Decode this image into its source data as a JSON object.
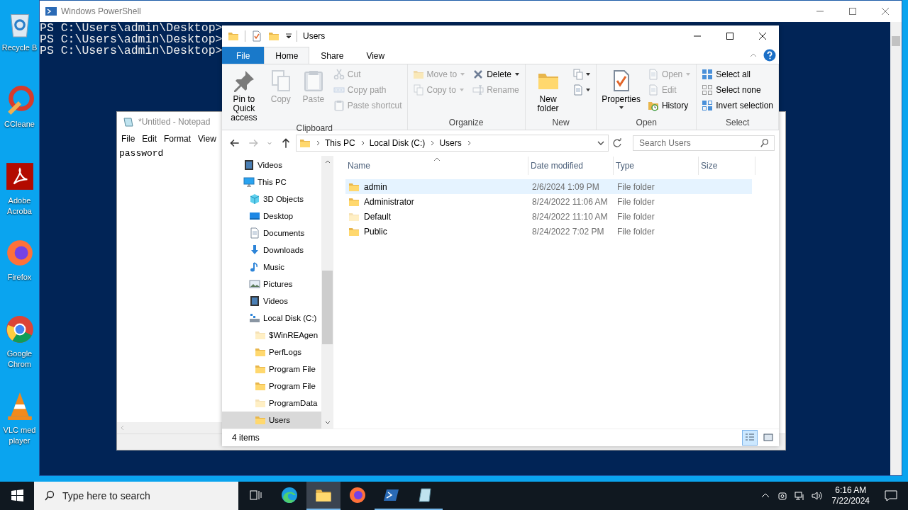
{
  "desktop": {
    "icons": [
      {
        "label": "Recycle B"
      },
      {
        "label": "CCleane"
      },
      {
        "label": "Adobe Acroba"
      },
      {
        "label": "Firefox"
      },
      {
        "label": "Google Chrom"
      },
      {
        "label": "VLC med player"
      }
    ]
  },
  "powershell": {
    "title": "Windows PowerShell",
    "lines": [
      "PS C:\\Users\\admin\\Desktop>",
      "PS C:\\Users\\admin\\Desktop>",
      "PS C:\\Users\\admin\\Desktop>"
    ]
  },
  "notepad": {
    "title": "*Untitled - Notepad",
    "menu": [
      "File",
      "Edit",
      "Format",
      "View"
    ],
    "text": "password"
  },
  "explorer": {
    "title": "Users",
    "tabs": [
      {
        "label": "File",
        "kind": "file",
        "selected": false
      },
      {
        "label": "Home",
        "kind": "tab",
        "selected": true
      },
      {
        "label": "Share",
        "kind": "tab",
        "selected": false
      },
      {
        "label": "View",
        "kind": "tab",
        "selected": false
      }
    ],
    "ribbon": {
      "groups": [
        {
          "label": "Clipboard",
          "columns": [
            [
              {
                "label": "Pin to Quick access",
                "kind": "large",
                "disabled": false
              }
            ],
            [
              {
                "label": "Copy",
                "kind": "large",
                "disabled": true
              }
            ],
            [
              {
                "label": "Paste",
                "kind": "large",
                "disabled": true
              }
            ],
            [
              {
                "label": "Cut",
                "kind": "small",
                "disabled": true
              },
              {
                "label": "Copy path",
                "kind": "small",
                "disabled": true
              },
              {
                "label": "Paste shortcut",
                "kind": "small",
                "disabled": true
              }
            ]
          ]
        },
        {
          "label": "Organize",
          "columns": [
            [
              {
                "label": "Move to",
                "kind": "small",
                "disabled": true,
                "dropdown": true
              },
              {
                "label": "Copy to",
                "kind": "small",
                "disabled": true,
                "dropdown": true
              }
            ],
            [
              {
                "label": "Delete",
                "kind": "small",
                "disabled": false,
                "dropdown": true
              },
              {
                "label": "Rename",
                "kind": "small",
                "disabled": true
              }
            ]
          ]
        },
        {
          "label": "New",
          "columns": [
            [
              {
                "label": "New folder",
                "kind": "large",
                "disabled": false
              }
            ],
            [
              {
                "kind": "icon",
                "disabled": false,
                "dropdown": true
              },
              {
                "kind": "icon",
                "disabled": false,
                "dropdown": true
              }
            ]
          ]
        },
        {
          "label": "Open",
          "columns": [
            [
              {
                "label": "Properties",
                "kind": "large",
                "disabled": false,
                "dropdown": true
              }
            ],
            [
              {
                "label": "Open",
                "kind": "small",
                "disabled": true,
                "dropdown": true
              },
              {
                "label": "Edit",
                "kind": "small",
                "disabled": true
              },
              {
                "label": "History",
                "kind": "small",
                "disabled": false
              }
            ]
          ]
        },
        {
          "label": "Select",
          "columns": [
            [
              {
                "label": "Select all",
                "kind": "small",
                "disabled": false
              },
              {
                "label": "Select none",
                "kind": "small",
                "disabled": false
              },
              {
                "label": "Invert selection",
                "kind": "small",
                "disabled": false
              }
            ]
          ]
        }
      ]
    },
    "address": {
      "crumbs": [
        "This PC",
        "Local Disk (C:)",
        "Users"
      ],
      "search_placeholder": "Search Users"
    },
    "nav": [
      {
        "label": "Videos",
        "selected": false,
        "hidden": false
      },
      {
        "label": "This PC",
        "selected": false,
        "hidden": false,
        "children": [
          {
            "label": "3D Objects",
            "selected": false,
            "hidden": false
          },
          {
            "label": "Desktop",
            "selected": false,
            "hidden": false
          },
          {
            "label": "Documents",
            "selected": false,
            "hidden": false
          },
          {
            "label": "Downloads",
            "selected": false,
            "hidden": false
          },
          {
            "label": "Music",
            "selected": false,
            "hidden": false
          },
          {
            "label": "Pictures",
            "selected": false,
            "hidden": false
          },
          {
            "label": "Videos",
            "selected": false,
            "hidden": false
          },
          {
            "label": "Local Disk (C:)",
            "selected": false,
            "hidden": false,
            "children": [
              {
                "label": "$WinREAgen",
                "selected": false,
                "hidden": true
              },
              {
                "label": "PerfLogs",
                "selected": false,
                "hidden": false
              },
              {
                "label": "Program File",
                "selected": false,
                "hidden": false
              },
              {
                "label": "Program File",
                "selected": false,
                "hidden": false
              },
              {
                "label": "ProgramData",
                "selected": false,
                "hidden": true
              },
              {
                "label": "Users",
                "selected": true,
                "hidden": false
              }
            ]
          }
        ]
      }
    ],
    "columns": [
      {
        "label": "Name",
        "sorted": true
      },
      {
        "label": "Date modified",
        "sorted": false
      },
      {
        "label": "Type",
        "sorted": false
      },
      {
        "label": "Size",
        "sorted": false
      }
    ],
    "rows": [
      {
        "name": "admin",
        "date": "2/6/2024 1:09 PM",
        "type": "File folder",
        "selected": true,
        "hidden": false
      },
      {
        "name": "Administrator",
        "date": "8/24/2022 11:06 AM",
        "type": "File folder",
        "selected": false,
        "hidden": false
      },
      {
        "name": "Default",
        "date": "8/24/2022 11:10 AM",
        "type": "File folder",
        "selected": false,
        "hidden": true
      },
      {
        "name": "Public",
        "date": "8/24/2022 7:02 PM",
        "type": "File folder",
        "selected": false,
        "hidden": false
      }
    ],
    "status": "4 items",
    "views": [
      {
        "kind": "details",
        "selected": true
      },
      {
        "kind": "tiles",
        "selected": false
      }
    ]
  },
  "taskbar": {
    "search_placeholder": "Type here to search",
    "apps": [
      {
        "kind": "task-view",
        "running": false,
        "active": false
      },
      {
        "kind": "edge",
        "running": false,
        "active": false
      },
      {
        "kind": "explorer",
        "running": true,
        "active": true
      },
      {
        "kind": "firefox",
        "running": false,
        "active": false
      },
      {
        "kind": "powershell",
        "running": true,
        "active": false
      },
      {
        "kind": "notepad",
        "running": true,
        "active": false
      }
    ],
    "time": "6:16 AM",
    "date": "7/22/2024"
  }
}
